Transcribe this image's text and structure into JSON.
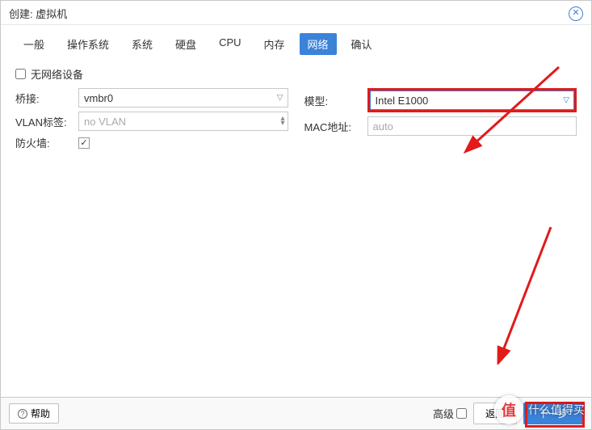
{
  "title": "创建: 虚拟机",
  "tabs": [
    "一般",
    "操作系统",
    "系统",
    "硬盘",
    "CPU",
    "内存",
    "网络",
    "确认"
  ],
  "active_tab_index": 6,
  "no_network_label": "无网络设备",
  "no_network_checked": false,
  "left_fields": {
    "bridge": {
      "label": "桥接:",
      "value": "vmbr0"
    },
    "vlan": {
      "label": "VLAN标签:",
      "value": "no VLAN"
    },
    "firewall": {
      "label": "防火墙:",
      "checked": true
    }
  },
  "right_fields": {
    "model": {
      "label": "模型:",
      "value": "Intel E1000"
    },
    "mac": {
      "label": "MAC地址:",
      "value": "auto"
    }
  },
  "footer": {
    "help": "帮助",
    "advanced": "高级",
    "advanced_checked": false,
    "back": "返回",
    "next": "下一步"
  },
  "watermark": {
    "icon_text": "值",
    "text": "什么值得买"
  }
}
